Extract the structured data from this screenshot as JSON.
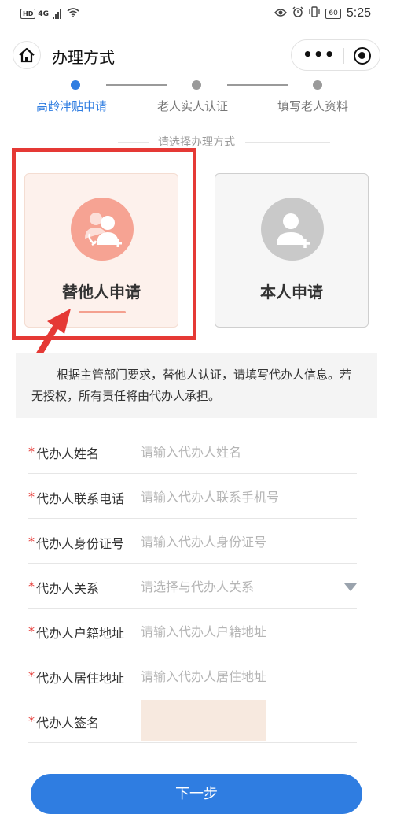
{
  "status_bar": {
    "hd": "HD",
    "network": "4G",
    "battery": "60",
    "time": "5:25"
  },
  "navbar": {
    "title": "办理方式"
  },
  "steps": [
    {
      "label": "高龄津贴申请",
      "active": true
    },
    {
      "label": "老人实人认证",
      "active": false
    },
    {
      "label": "填写老人资料",
      "active": false
    }
  ],
  "choose_hint": "请选择办理方式",
  "options": {
    "other": {
      "label": "替他人申请",
      "selected": true
    },
    "self": {
      "label": "本人申请",
      "selected": false
    }
  },
  "notice": "根据主管部门要求，替他人认证，请填写代办人信息。若无授权，所有责任将由代办人承担。",
  "form": {
    "required_mark": "*",
    "fields": [
      {
        "label": "代办人姓名",
        "placeholder": "请输入代办人姓名"
      },
      {
        "label": "代办人联系电话",
        "placeholder": "请输入代办人联系手机号"
      },
      {
        "label": "代办人身份证号",
        "placeholder": "请输入代办人身份证号"
      },
      {
        "label": "代办人关系",
        "placeholder": "请选择与代办人关系"
      },
      {
        "label": "代办人户籍地址",
        "placeholder": "请输入代办人户籍地址"
      },
      {
        "label": "代办人居住地址",
        "placeholder": "请输入代办人居住地址"
      },
      {
        "label": "代办人签名",
        "placeholder": ""
      }
    ]
  },
  "next_button": "下一步",
  "colors": {
    "accent": "#2f7de1",
    "highlight_frame": "#e53935",
    "selected_card": "#fdf1ec"
  }
}
